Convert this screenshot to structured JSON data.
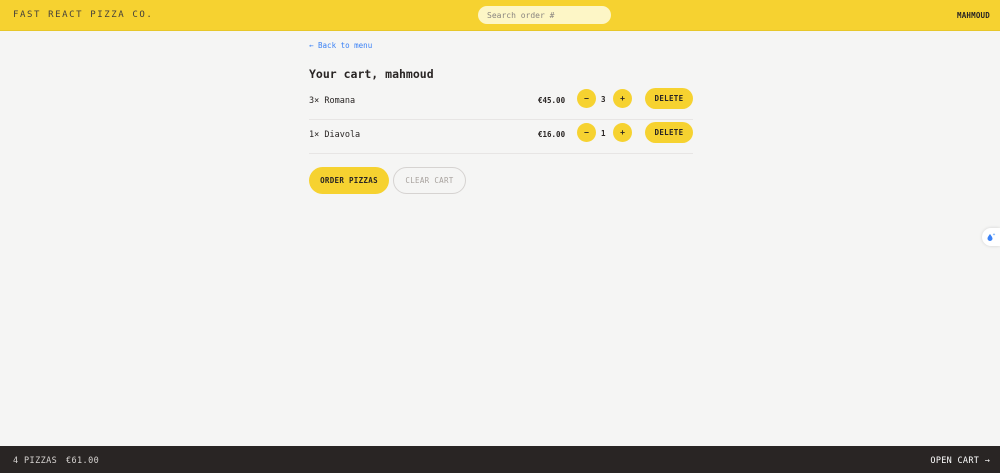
{
  "header": {
    "logo": "FAST REACT PIZZA CO.",
    "search_placeholder": "Search order #",
    "username": "MAHMOUD"
  },
  "main": {
    "back_link": "← Back to menu",
    "title": "Your cart, mahmoud",
    "items": [
      {
        "name": "3× Romana",
        "price": "€45.00",
        "quantity": "3",
        "minus": "−",
        "plus": "+",
        "delete": "DELETE"
      },
      {
        "name": "1× Diavola",
        "price": "€16.00",
        "quantity": "1",
        "minus": "−",
        "plus": "+",
        "delete": "DELETE"
      }
    ],
    "order_button": "ORDER PIZZAS",
    "clear_button": "CLEAR CART"
  },
  "footer": {
    "pizza_count": "4 PIZZAS",
    "total": "€61.00",
    "open_cart": "OPEN CART →"
  },
  "colors": {
    "brand_yellow": "#f6d230",
    "footer_bg": "#292524",
    "link_blue": "#3b82f6",
    "page_bg": "#f5f5f4"
  },
  "icons": {
    "side_widget": "droplet-sparkle-icon"
  }
}
